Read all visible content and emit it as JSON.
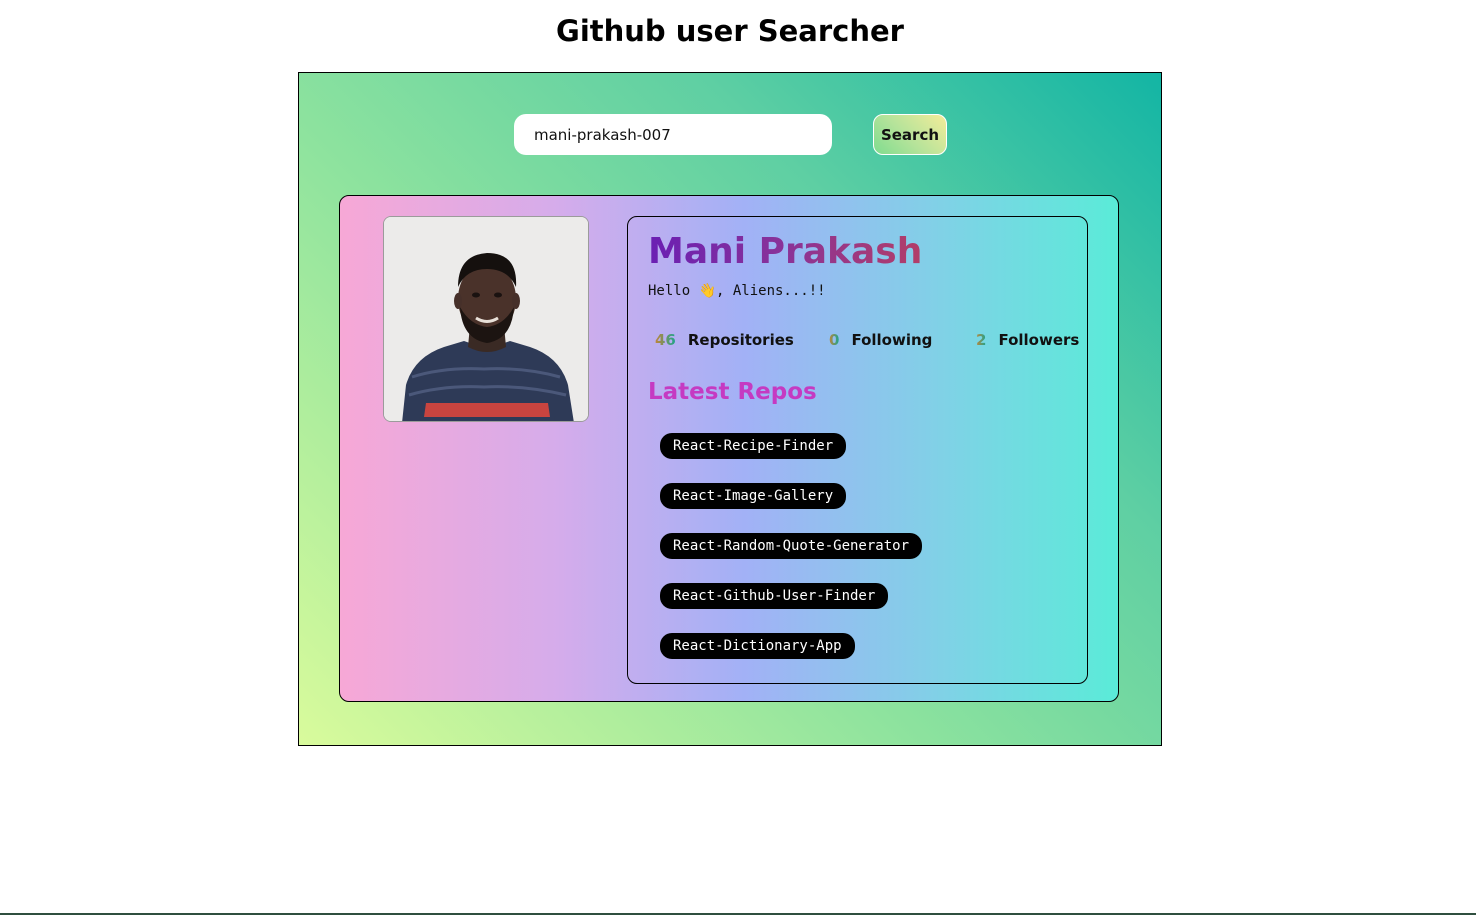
{
  "header": {
    "title": "Github user Searcher"
  },
  "search": {
    "value": "mani-prakash-007",
    "button_label": "Search"
  },
  "profile": {
    "name": "Mani Prakash",
    "bio": "Hello 👋, Aliens...!!",
    "stats": {
      "repositories": {
        "count": "46",
        "label": "Repositories"
      },
      "following": {
        "count": "0",
        "label": "Following"
      },
      "followers": {
        "count": "2",
        "label": "Followers"
      }
    },
    "latest_repos_heading": "Latest Repos",
    "repos": [
      "React-Recipe-Finder",
      "React-Image-Gallery",
      "React-Random-Quote-Generator",
      "React-Github-User-Finder",
      "React-Dictionary-App"
    ]
  },
  "colors": {
    "frame_gradient_start": "#13b5a4",
    "frame_gradient_end": "#d9fb9c",
    "card_gradient_start": "#f7a8d6",
    "card_gradient_end": "#5aebd8",
    "name_gradient_start": "#6a1fb3",
    "name_gradient_end": "#b23e68",
    "repos_heading": "#c53ac2",
    "repo_chip_bg": "#000000",
    "repo_chip_text": "#ffffff"
  },
  "icons": {
    "avatar": "user-photo"
  }
}
